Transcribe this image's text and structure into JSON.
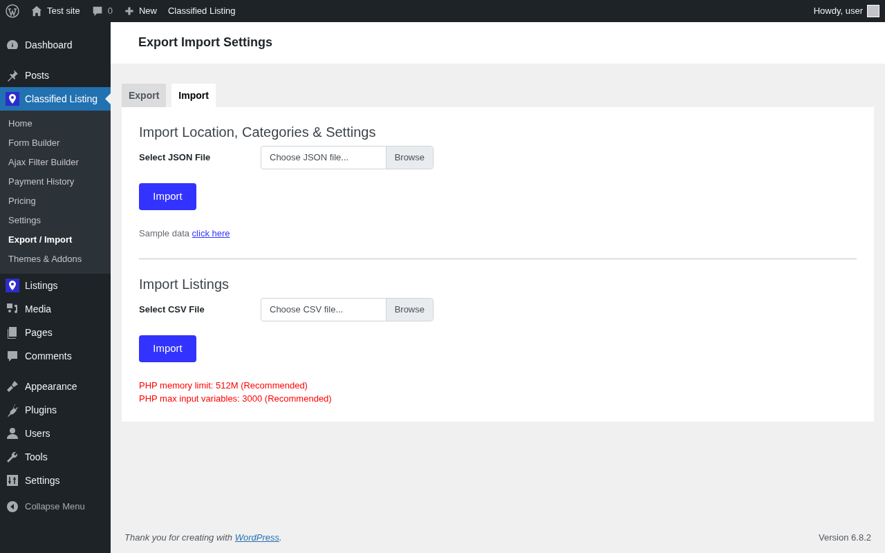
{
  "admin_bar": {
    "site": "Test site",
    "comments": "0",
    "new": "New",
    "plugin": "Classified Listing",
    "greeting": "Howdy, user"
  },
  "sidebar": {
    "groups": [
      [
        {
          "label": "Dashboard",
          "selected": false
        }
      ],
      [
        {
          "label": "Posts",
          "selected": false
        },
        {
          "label": "Classified Listing",
          "selected": true,
          "children": [
            {
              "label": "Home",
              "selected": false
            },
            {
              "label": "Form Builder",
              "selected": false
            },
            {
              "label": "Ajax Filter Builder",
              "selected": false
            },
            {
              "label": "Payment History",
              "selected": false
            },
            {
              "label": "Pricing",
              "selected": false
            },
            {
              "label": "Settings",
              "selected": false
            },
            {
              "label": "Export / Import",
              "selected": true
            },
            {
              "label": "Themes & Addons",
              "selected": false
            }
          ]
        },
        {
          "label": "Listings",
          "selected": false
        },
        {
          "label": "Media",
          "selected": false
        },
        {
          "label": "Pages",
          "selected": false
        },
        {
          "label": "Comments",
          "selected": false
        }
      ],
      [
        {
          "label": "Appearance",
          "selected": false
        },
        {
          "label": "Plugins",
          "selected": false
        },
        {
          "label": "Users",
          "selected": false
        },
        {
          "label": "Tools",
          "selected": false
        },
        {
          "label": "Settings",
          "selected": false
        }
      ]
    ],
    "collapse": "Collapse Menu"
  },
  "page_title": "Export Import Settings",
  "tabs": [
    {
      "label": "Export",
      "selected": false
    },
    {
      "label": "Import",
      "selected": true
    }
  ],
  "sections": [
    {
      "title": "Import Location, Categories & Settings",
      "field_label": "Select JSON File",
      "placeholder": "Choose JSON file...",
      "browse": "Browse",
      "button": "Import",
      "note": {
        "text": "Sample data",
        "link": "click here"
      }
    },
    {
      "title": "Import Listings",
      "field_label": "Select CSV File",
      "placeholder": "Choose CSV file...",
      "browse": "Browse",
      "button": "Import",
      "warnings": [
        "PHP memory limit: 512M (Recommended)",
        "PHP max input variables: 3000 (Recommended)"
      ]
    }
  ],
  "footer": {
    "text": "Thank you for creating with",
    "link": "WordPress",
    "after": ".",
    "version": "Version 6.8.2"
  }
}
